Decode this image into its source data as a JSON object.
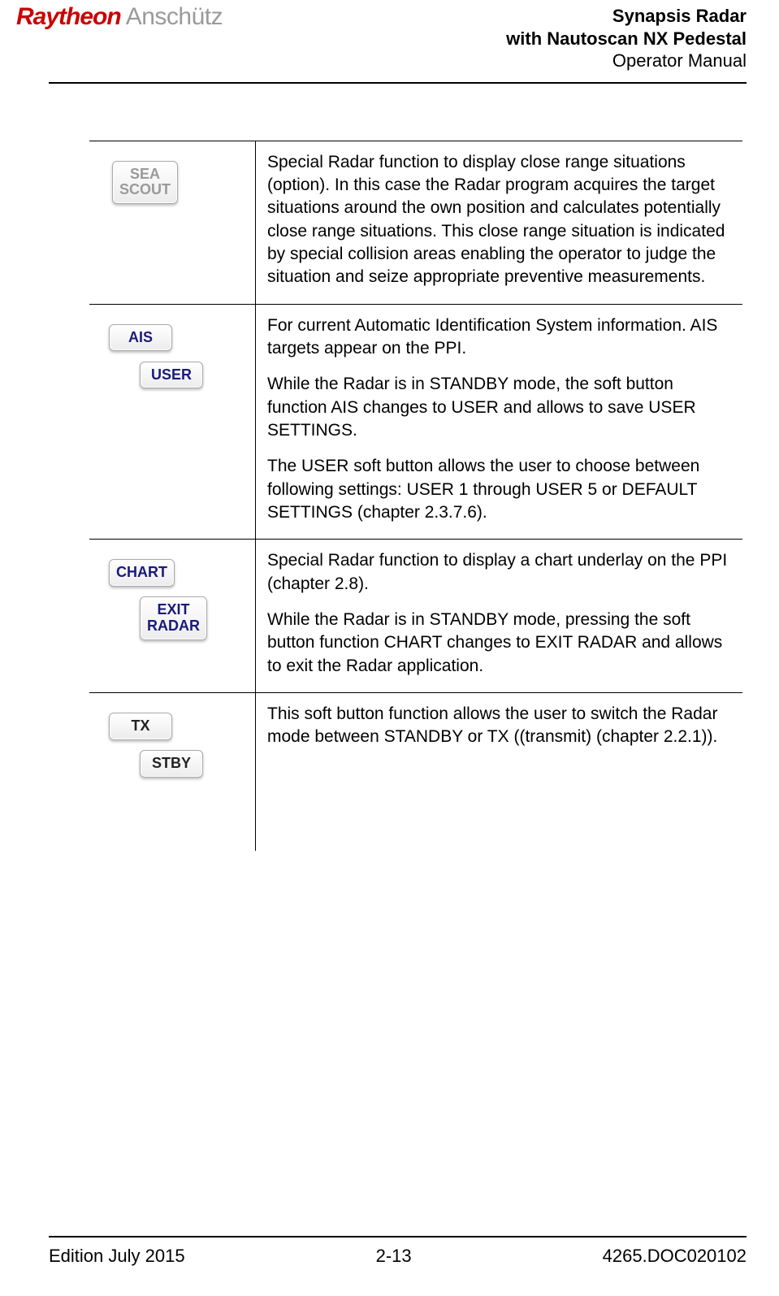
{
  "header": {
    "brand1": "Raytheon",
    "brand2": "Anschütz",
    "title_line1": "Synapsis Radar",
    "title_line2": "with Nautoscan NX Pedestal",
    "title_line3": "Operator Manual"
  },
  "rows": [
    {
      "buttons": [
        {
          "label": "SEA\nSCOUT",
          "style": "gray"
        }
      ],
      "paragraphs": [
        "Special Radar function to display close range situations (option). In this case the Radar program acquires the target situations around the own position and calculates potentially close range situations. This close range situation is indicated by special collision areas enabling the operator to judge the situation and seize appropriate preventive measurements."
      ]
    },
    {
      "buttons": [
        {
          "label": "AIS",
          "style": "blue"
        },
        {
          "label": "USER",
          "style": "blue"
        }
      ],
      "paragraphs": [
        "For current Automatic Identification System information. AIS targets appear on the PPI.",
        "While the Radar is in STANDBY mode, the soft button function AIS changes to USER and allows to save USER SETTINGS.",
        "The USER soft button allows the user to choose between following settings: USER 1 through USER 5 or DEFAULT SETTINGS (chapter 2.3.7.6)."
      ]
    },
    {
      "buttons": [
        {
          "label": "CHART",
          "style": "blue"
        },
        {
          "label": "EXIT\nRADAR",
          "style": "blue"
        }
      ],
      "paragraphs": [
        "Special Radar function to display a chart underlay on the PPI (chapter 2.8).",
        "While the Radar is in STANDBY mode, pressing the soft button function CHART changes to EXIT RADAR and allows to exit the Radar application."
      ]
    },
    {
      "buttons": [
        {
          "label": "TX",
          "style": "black"
        },
        {
          "label": "STBY",
          "style": "black"
        }
      ],
      "paragraphs": [
        "This soft button function allows the user to switch the Radar mode between STANDBY or TX ((transmit) (chapter 2.2.1))."
      ]
    }
  ],
  "footer": {
    "left": "Edition July 2015",
    "center": "2-13",
    "right": "4265.DOC020102"
  }
}
